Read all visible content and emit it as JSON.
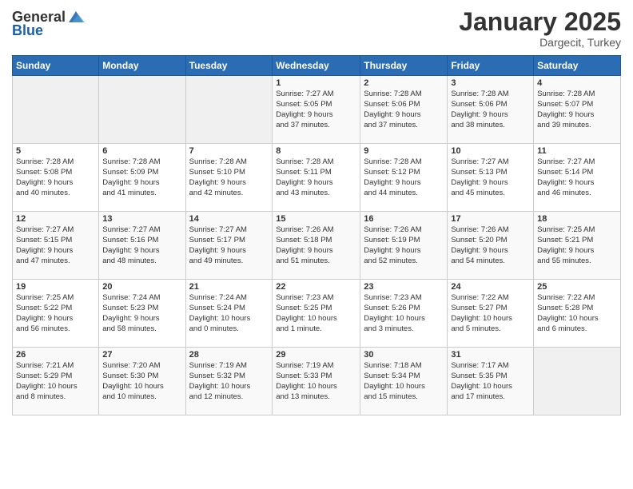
{
  "header": {
    "logo_general": "General",
    "logo_blue": "Blue",
    "month_title": "January 2025",
    "location": "Dargecit, Turkey"
  },
  "weekdays": [
    "Sunday",
    "Monday",
    "Tuesday",
    "Wednesday",
    "Thursday",
    "Friday",
    "Saturday"
  ],
  "weeks": [
    [
      {
        "day": "",
        "content": ""
      },
      {
        "day": "",
        "content": ""
      },
      {
        "day": "",
        "content": ""
      },
      {
        "day": "1",
        "content": "Sunrise: 7:27 AM\nSunset: 5:05 PM\nDaylight: 9 hours\nand 37 minutes."
      },
      {
        "day": "2",
        "content": "Sunrise: 7:28 AM\nSunset: 5:06 PM\nDaylight: 9 hours\nand 37 minutes."
      },
      {
        "day": "3",
        "content": "Sunrise: 7:28 AM\nSunset: 5:06 PM\nDaylight: 9 hours\nand 38 minutes."
      },
      {
        "day": "4",
        "content": "Sunrise: 7:28 AM\nSunset: 5:07 PM\nDaylight: 9 hours\nand 39 minutes."
      }
    ],
    [
      {
        "day": "5",
        "content": "Sunrise: 7:28 AM\nSunset: 5:08 PM\nDaylight: 9 hours\nand 40 minutes."
      },
      {
        "day": "6",
        "content": "Sunrise: 7:28 AM\nSunset: 5:09 PM\nDaylight: 9 hours\nand 41 minutes."
      },
      {
        "day": "7",
        "content": "Sunrise: 7:28 AM\nSunset: 5:10 PM\nDaylight: 9 hours\nand 42 minutes."
      },
      {
        "day": "8",
        "content": "Sunrise: 7:28 AM\nSunset: 5:11 PM\nDaylight: 9 hours\nand 43 minutes."
      },
      {
        "day": "9",
        "content": "Sunrise: 7:28 AM\nSunset: 5:12 PM\nDaylight: 9 hours\nand 44 minutes."
      },
      {
        "day": "10",
        "content": "Sunrise: 7:27 AM\nSunset: 5:13 PM\nDaylight: 9 hours\nand 45 minutes."
      },
      {
        "day": "11",
        "content": "Sunrise: 7:27 AM\nSunset: 5:14 PM\nDaylight: 9 hours\nand 46 minutes."
      }
    ],
    [
      {
        "day": "12",
        "content": "Sunrise: 7:27 AM\nSunset: 5:15 PM\nDaylight: 9 hours\nand 47 minutes."
      },
      {
        "day": "13",
        "content": "Sunrise: 7:27 AM\nSunset: 5:16 PM\nDaylight: 9 hours\nand 48 minutes."
      },
      {
        "day": "14",
        "content": "Sunrise: 7:27 AM\nSunset: 5:17 PM\nDaylight: 9 hours\nand 49 minutes."
      },
      {
        "day": "15",
        "content": "Sunrise: 7:26 AM\nSunset: 5:18 PM\nDaylight: 9 hours\nand 51 minutes."
      },
      {
        "day": "16",
        "content": "Sunrise: 7:26 AM\nSunset: 5:19 PM\nDaylight: 9 hours\nand 52 minutes."
      },
      {
        "day": "17",
        "content": "Sunrise: 7:26 AM\nSunset: 5:20 PM\nDaylight: 9 hours\nand 54 minutes."
      },
      {
        "day": "18",
        "content": "Sunrise: 7:25 AM\nSunset: 5:21 PM\nDaylight: 9 hours\nand 55 minutes."
      }
    ],
    [
      {
        "day": "19",
        "content": "Sunrise: 7:25 AM\nSunset: 5:22 PM\nDaylight: 9 hours\nand 56 minutes."
      },
      {
        "day": "20",
        "content": "Sunrise: 7:24 AM\nSunset: 5:23 PM\nDaylight: 9 hours\nand 58 minutes."
      },
      {
        "day": "21",
        "content": "Sunrise: 7:24 AM\nSunset: 5:24 PM\nDaylight: 10 hours\nand 0 minutes."
      },
      {
        "day": "22",
        "content": "Sunrise: 7:23 AM\nSunset: 5:25 PM\nDaylight: 10 hours\nand 1 minute."
      },
      {
        "day": "23",
        "content": "Sunrise: 7:23 AM\nSunset: 5:26 PM\nDaylight: 10 hours\nand 3 minutes."
      },
      {
        "day": "24",
        "content": "Sunrise: 7:22 AM\nSunset: 5:27 PM\nDaylight: 10 hours\nand 5 minutes."
      },
      {
        "day": "25",
        "content": "Sunrise: 7:22 AM\nSunset: 5:28 PM\nDaylight: 10 hours\nand 6 minutes."
      }
    ],
    [
      {
        "day": "26",
        "content": "Sunrise: 7:21 AM\nSunset: 5:29 PM\nDaylight: 10 hours\nand 8 minutes."
      },
      {
        "day": "27",
        "content": "Sunrise: 7:20 AM\nSunset: 5:30 PM\nDaylight: 10 hours\nand 10 minutes."
      },
      {
        "day": "28",
        "content": "Sunrise: 7:19 AM\nSunset: 5:32 PM\nDaylight: 10 hours\nand 12 minutes."
      },
      {
        "day": "29",
        "content": "Sunrise: 7:19 AM\nSunset: 5:33 PM\nDaylight: 10 hours\nand 13 minutes."
      },
      {
        "day": "30",
        "content": "Sunrise: 7:18 AM\nSunset: 5:34 PM\nDaylight: 10 hours\nand 15 minutes."
      },
      {
        "day": "31",
        "content": "Sunrise: 7:17 AM\nSunset: 5:35 PM\nDaylight: 10 hours\nand 17 minutes."
      },
      {
        "day": "",
        "content": ""
      }
    ]
  ]
}
